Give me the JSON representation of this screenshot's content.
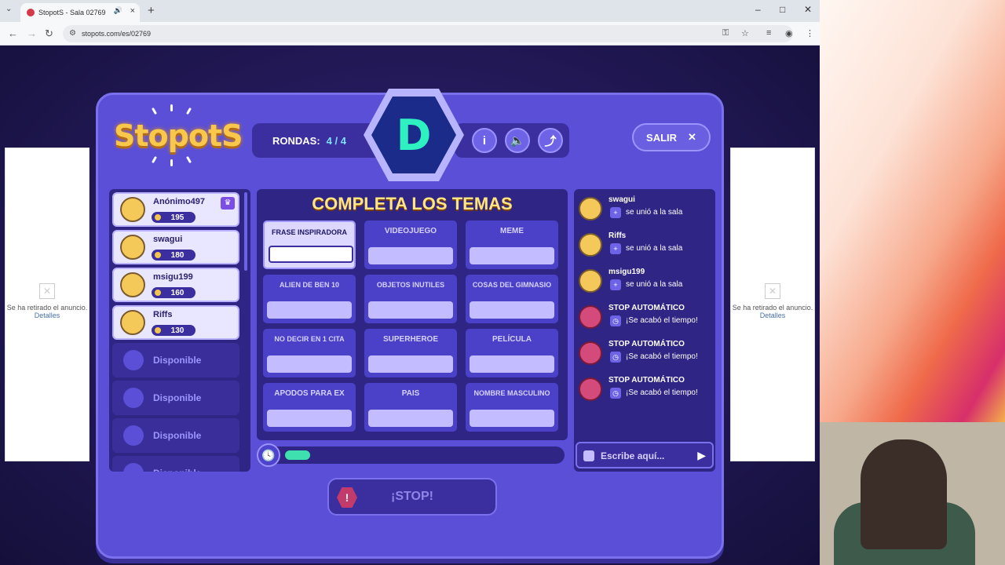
{
  "browser": {
    "tab_title": "StopotS - Sala 02769",
    "url": "stopots.com/es/02769"
  },
  "ads": {
    "left_text": "Se ha retirado el anuncio.",
    "left_link": "Detalles",
    "right_text": "Se ha retirado el anuncio.",
    "right_link": "Detalles"
  },
  "game": {
    "logo": "StopotS",
    "rounds_label": "RONDAS:",
    "rounds_value": "4 / 4",
    "letter": "D",
    "exit_label": "SALIR",
    "themes_title": "COMPLETA LOS TEMAS",
    "stop_label": "¡STOP!",
    "timer_progress": 0.09
  },
  "players": [
    {
      "name": "Anónimo497",
      "score": "195",
      "host": true
    },
    {
      "name": "swagui",
      "score": "180"
    },
    {
      "name": "msigu199",
      "score": "160"
    },
    {
      "name": "Riffs",
      "score": "130"
    },
    {
      "name": "Disponible",
      "empty": true
    },
    {
      "name": "Disponible",
      "empty": true
    },
    {
      "name": "Disponible",
      "empty": true
    },
    {
      "name": "Disponible",
      "empty": true
    }
  ],
  "themes": [
    {
      "label": "FRASE INSPIRADORA",
      "value": ""
    },
    {
      "label": "VIDEOJUEGO",
      "value": ""
    },
    {
      "label": "MEME",
      "value": ""
    },
    {
      "label": "ALIEN DE BEN 10",
      "value": ""
    },
    {
      "label": "OBJETOS INUTILES",
      "value": ""
    },
    {
      "label": "COSAS DEL GIMNASIO",
      "value": ""
    },
    {
      "label": "NO DECIR EN 1 CITA",
      "value": ""
    },
    {
      "label": "SUPERHEROE",
      "value": ""
    },
    {
      "label": "PELÍCULA",
      "value": ""
    },
    {
      "label": "APODOS PARA EX",
      "value": ""
    },
    {
      "label": "PAIS",
      "value": ""
    },
    {
      "label": "NOMBRE MASCULINO",
      "value": ""
    }
  ],
  "chat": {
    "placeholder": "Escribe aquí...",
    "messages": [
      {
        "name": "swagui",
        "text": "se unió a la sala"
      },
      {
        "name": "Riffs",
        "text": "se unió a la sala"
      },
      {
        "name": "msigu199",
        "text": "se unió a la sala"
      },
      {
        "name": "STOP AUTOMÁTICO",
        "text": "¡Se acabó el tiempo!"
      },
      {
        "name": "STOP AUTOMÁTICO",
        "text": "¡Se acabó el tiempo!"
      },
      {
        "name": "STOP AUTOMÁTICO",
        "text": "¡Se acabó el tiempo!"
      }
    ]
  }
}
